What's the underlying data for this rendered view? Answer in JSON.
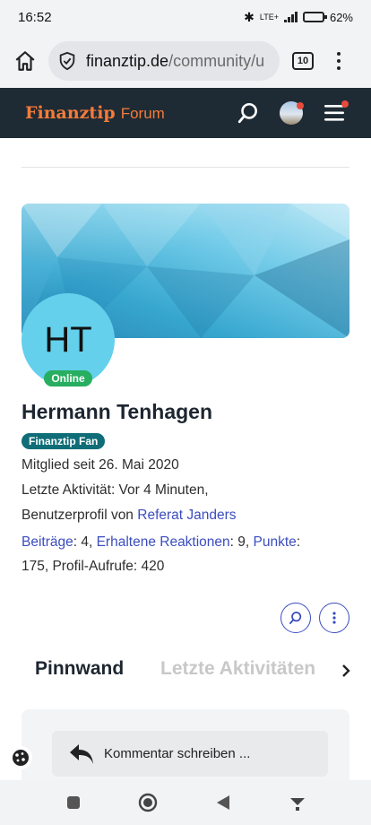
{
  "status": {
    "time": "16:52",
    "network": "LTE+",
    "battery": "62%",
    "battery_level": 0.62
  },
  "browser": {
    "url_domain": "finanztip.de",
    "url_path": "/community/u",
    "tab_count": "10"
  },
  "header": {
    "brand": "Finanztip",
    "section": "Forum"
  },
  "profile": {
    "initials": "HT",
    "online": "Online",
    "name": "Hermann Tenhagen",
    "badge": "Finanztip Fan",
    "member_since": "Mitglied seit 26. Mai 2020",
    "last_activity": "Letzte Aktivität: Vor 4 Minuten,",
    "profile_by_prefix": "Benutzerprofil von ",
    "profile_by_link": "Referat Janders",
    "stats": {
      "posts_label": "Beiträge",
      "posts_value": ": 4, ",
      "reactions_label": "Erhaltene Reaktionen",
      "reactions_value": ": 9, ",
      "points_label": "Punkte",
      "points_value": ":",
      "line2": "175, Profil-Aufrufe: 420"
    }
  },
  "tabs": {
    "active": "Pinnwand",
    "inactive": "Letzte Aktivitäten"
  },
  "comment": {
    "placeholder": "Kommentar schreiben ..."
  }
}
